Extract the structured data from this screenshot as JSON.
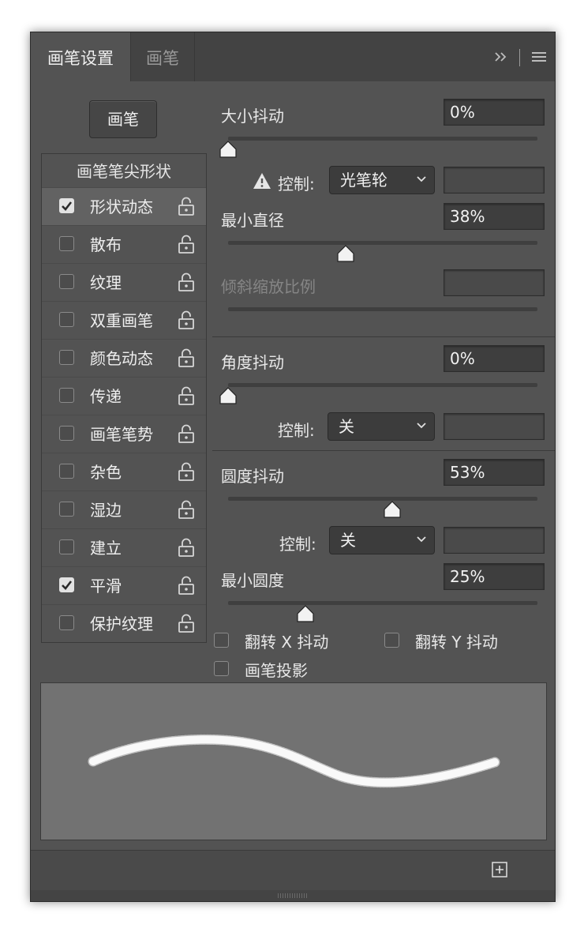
{
  "tabs": {
    "active": "画笔设置",
    "other": "画笔"
  },
  "header_icons": [
    "double-chevron-right-icon",
    "separator",
    "hamburger-menu-icon"
  ],
  "brush_button": "画笔",
  "sidebar": {
    "header": "画笔笔尖形状",
    "items": [
      {
        "label": "形状动态",
        "checked": true,
        "selected": true
      },
      {
        "label": "散布",
        "checked": false
      },
      {
        "label": "纹理",
        "checked": false
      },
      {
        "label": "双重画笔",
        "checked": false
      },
      {
        "label": "颜色动态",
        "checked": false
      },
      {
        "label": "传递",
        "checked": false
      },
      {
        "label": "画笔笔势",
        "checked": false
      },
      {
        "label": "杂色",
        "checked": false
      },
      {
        "label": "湿边",
        "checked": false
      },
      {
        "label": "建立",
        "checked": false
      },
      {
        "label": "平滑",
        "checked": true
      },
      {
        "label": "保护纹理",
        "checked": false
      }
    ]
  },
  "settings": {
    "size_jitter": {
      "label": "大小抖动",
      "value": "0%",
      "slider": 0.0
    },
    "size_control": {
      "label": "控制:",
      "value": "光笔轮",
      "warning": true
    },
    "min_diameter": {
      "label": "最小直径",
      "value": "38%",
      "slider": 0.38
    },
    "tilt_scale": {
      "label": "倾斜缩放比例",
      "value": "",
      "disabled": true
    },
    "angle_jitter": {
      "label": "角度抖动",
      "value": "0%",
      "slider": 0.0
    },
    "angle_control": {
      "label": "控制:",
      "value": "关"
    },
    "roundness_jitter": {
      "label": "圆度抖动",
      "value": "53%",
      "slider": 0.53
    },
    "roundness_control": {
      "label": "控制:",
      "value": "关"
    },
    "min_roundness": {
      "label": "最小圆度",
      "value": "25%",
      "slider": 0.25
    },
    "flip_x": {
      "label": "翻转 X 抖动",
      "checked": false
    },
    "flip_y": {
      "label": "翻转 Y 抖动",
      "checked": false
    },
    "brush_projection": {
      "label": "画笔投影",
      "checked": false
    }
  },
  "footer_icons": [
    "new-brush-icon"
  ]
}
